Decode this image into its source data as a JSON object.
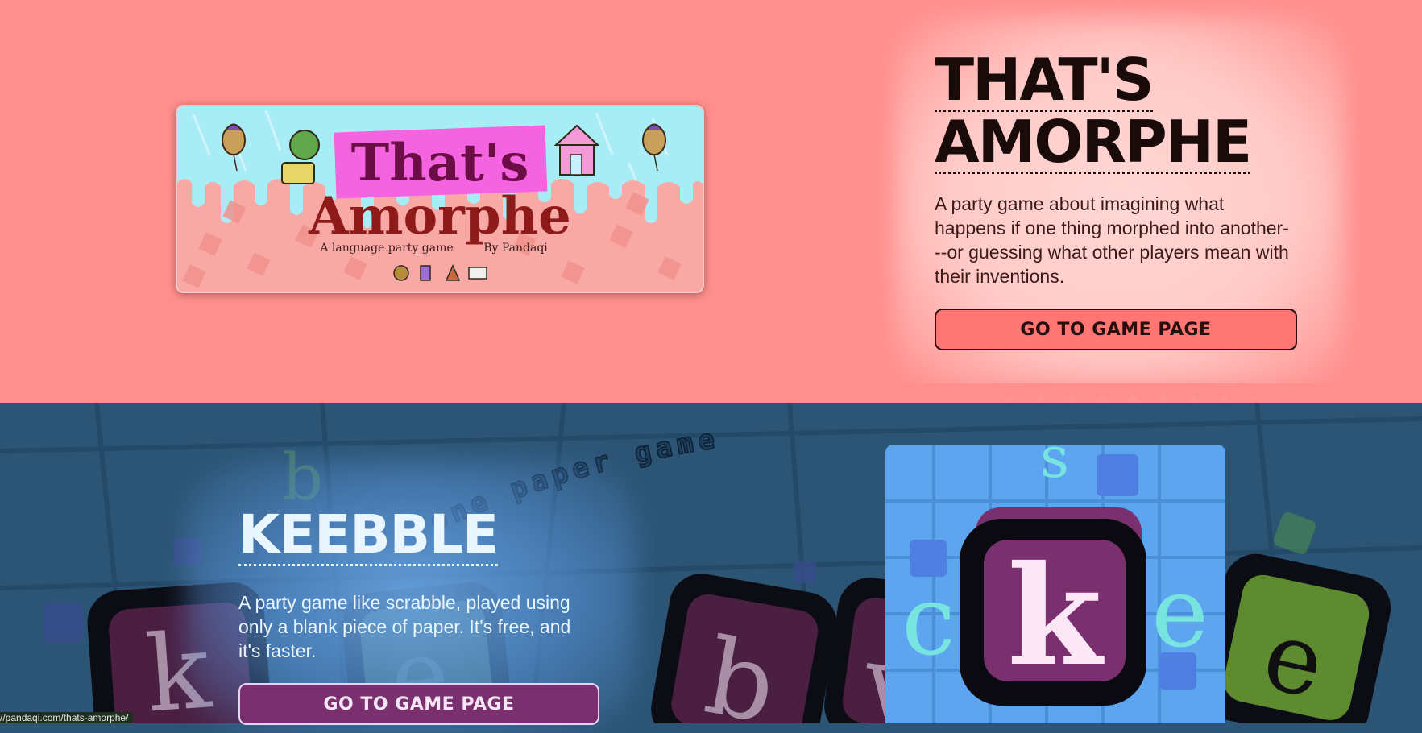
{
  "games": [
    {
      "title_line1": "THAT'S",
      "title_line2": "AMORPHE",
      "description": "A party game about imagining what happens if one thing morphed into another---or guessing what other players mean with their inventions.",
      "button_label": "GO TO GAME PAGE",
      "banner": {
        "title_top": "That's",
        "title_bottom": "Amorphe",
        "subtitle": "A language party game",
        "byline": "By Pandaqi"
      },
      "colors": {
        "background": "#ff8f8d",
        "button": "#ff7673",
        "text": "#1a0b0b"
      }
    },
    {
      "title": "KEEBBLE",
      "description": "A party game like scrabble, played using only a blank piece of paper. It's free, and it's faster.",
      "button_label": "GO TO GAME PAGE",
      "curved_tagline": "one paper game",
      "card_letter": "k",
      "colors": {
        "background": "#2c5475",
        "button": "#7a2f6f",
        "text": "#eaf6ff"
      }
    }
  ],
  "background_letters": [
    "b",
    "k",
    "e",
    "e",
    "b",
    "v",
    "s",
    "c",
    "e"
  ],
  "status_bar": {
    "url": "//pandaqi.com/thats-amorphe/"
  }
}
